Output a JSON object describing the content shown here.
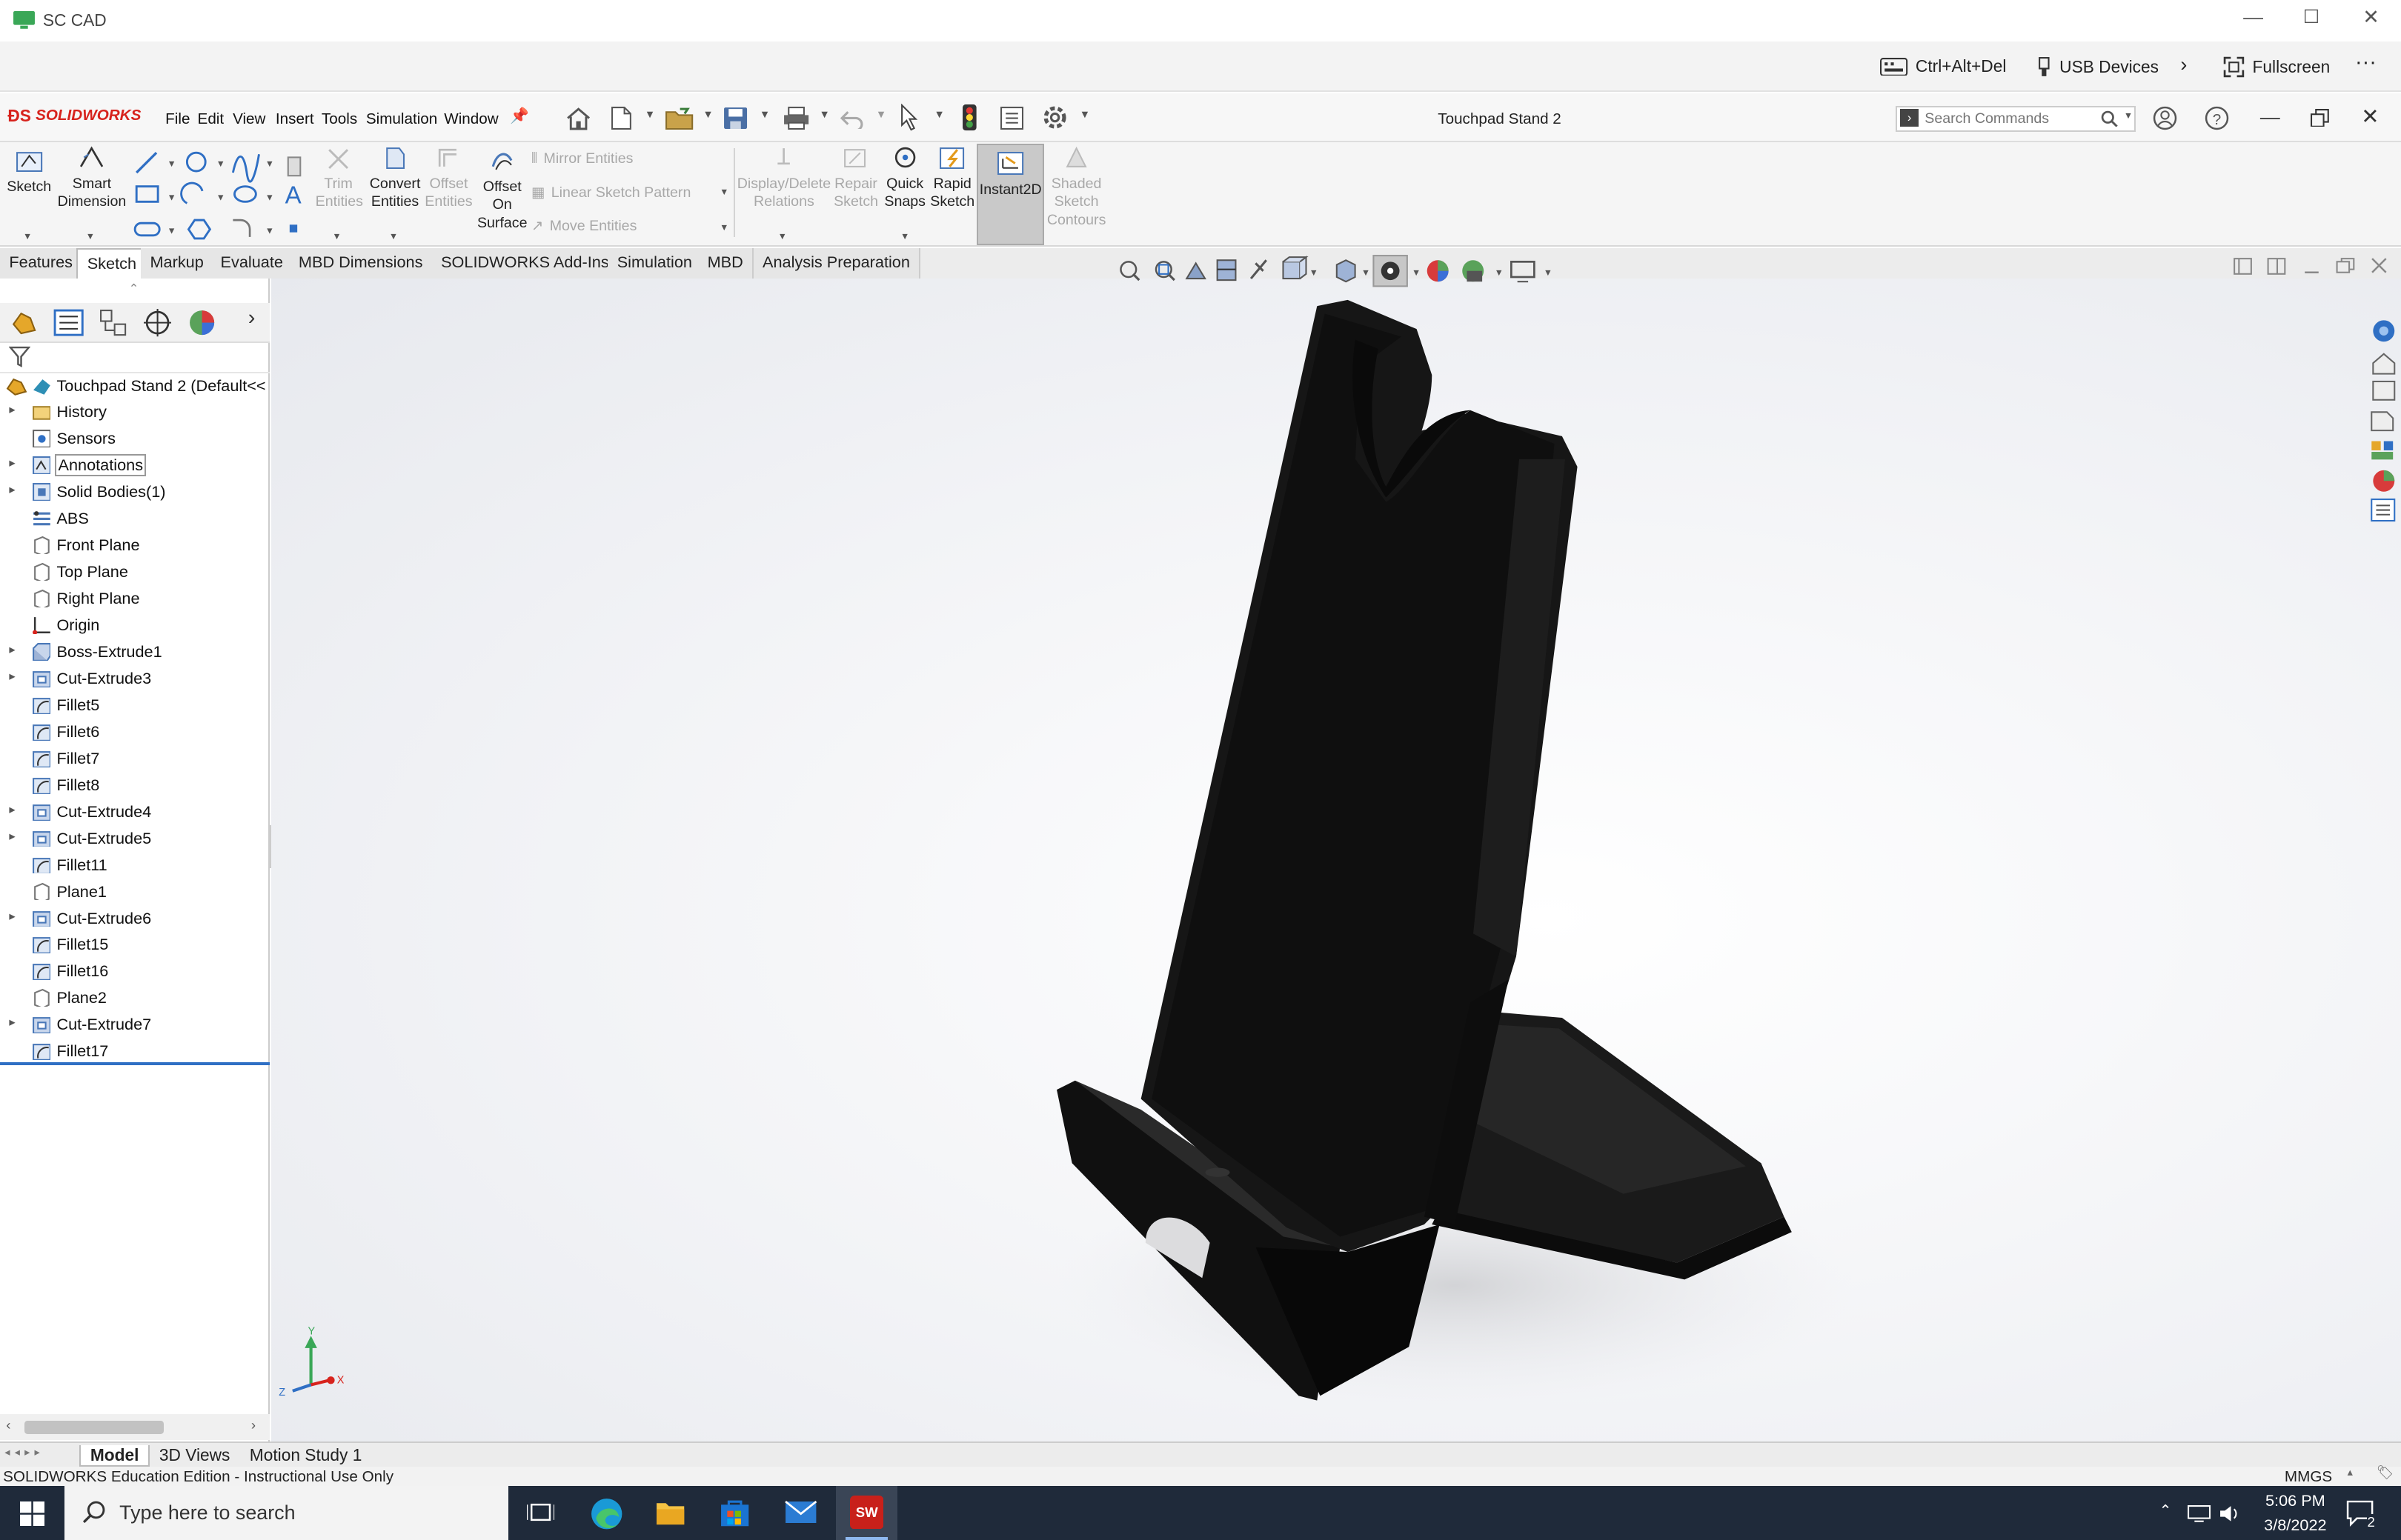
{
  "window": {
    "app_title": "SC CAD"
  },
  "remote": {
    "cad_label": "Ctrl+Alt+Del",
    "usb_label": "USB Devices",
    "fullscreen_label": "Fullscreen",
    "more": "···"
  },
  "menubar": {
    "brand": "SOLIDWORKS",
    "items": [
      "File",
      "Edit",
      "View",
      "Insert",
      "Tools",
      "Simulation",
      "Window"
    ],
    "doc_title": "Touchpad Stand 2",
    "search_placeholder": "Search Commands"
  },
  "commands": {
    "sketch": "Sketch",
    "smart_dim_1": "Smart",
    "smart_dim_2": "Dimension",
    "trim_1": "Trim",
    "trim_2": "Entities",
    "convert_1": "Convert",
    "convert_2": "Entities",
    "offset_1": "Offset",
    "offset_2": "Entities",
    "offset_surf_1": "Offset",
    "offset_surf_2": "On",
    "offset_surf_3": "Surface",
    "mirror": "Mirror Entities",
    "linear_pattern": "Linear Sketch Pattern",
    "move": "Move Entities",
    "display_1": "Display/Delete",
    "display_2": "Relations",
    "repair_1": "Repair",
    "repair_2": "Sketch",
    "quick_1": "Quick",
    "quick_2": "Snaps",
    "rapid_1": "Rapid",
    "rapid_2": "Sketch",
    "instant2d": "Instant2D",
    "shaded_1": "Shaded",
    "shaded_2": "Sketch",
    "shaded_3": "Contours"
  },
  "tabs": [
    "Features",
    "Sketch",
    "Markup",
    "Evaluate",
    "MBD Dimensions",
    "SOLIDWORKS Add-Ins",
    "Simulation",
    "MBD",
    "Analysis Preparation"
  ],
  "active_tab": "Sketch",
  "tree": {
    "root": "Touchpad Stand 2  (Default<<",
    "items": [
      {
        "label": "History",
        "icon": "history-folder-icon",
        "expandable": true
      },
      {
        "label": "Sensors",
        "icon": "sensor-icon",
        "expandable": false
      },
      {
        "label": "Annotations",
        "icon": "annotations-icon",
        "expandable": true
      },
      {
        "label": "Solid Bodies(1)",
        "icon": "solid-bodies-icon",
        "expandable": true
      },
      {
        "label": "ABS",
        "icon": "material-icon",
        "expandable": false
      },
      {
        "label": "Front Plane",
        "icon": "plane-icon",
        "expandable": false
      },
      {
        "label": "Top Plane",
        "icon": "plane-icon",
        "expandable": false
      },
      {
        "label": "Right Plane",
        "icon": "plane-icon",
        "expandable": false
      },
      {
        "label": "Origin",
        "icon": "origin-icon",
        "expandable": false
      },
      {
        "label": "Boss-Extrude1",
        "icon": "extrude-icon",
        "expandable": true
      },
      {
        "label": "Cut-Extrude3",
        "icon": "cut-extrude-icon",
        "expandable": true
      },
      {
        "label": "Fillet5",
        "icon": "fillet-icon",
        "expandable": false
      },
      {
        "label": "Fillet6",
        "icon": "fillet-icon",
        "expandable": false
      },
      {
        "label": "Fillet7",
        "icon": "fillet-icon",
        "expandable": false
      },
      {
        "label": "Fillet8",
        "icon": "fillet-icon",
        "expandable": false
      },
      {
        "label": "Cut-Extrude4",
        "icon": "cut-extrude-icon",
        "expandable": true
      },
      {
        "label": "Cut-Extrude5",
        "icon": "cut-extrude-icon",
        "expandable": true
      },
      {
        "label": "Fillet11",
        "icon": "fillet-icon",
        "expandable": false
      },
      {
        "label": "Plane1",
        "icon": "plane-icon",
        "expandable": false
      },
      {
        "label": "Cut-Extrude6",
        "icon": "cut-extrude-icon",
        "expandable": true
      },
      {
        "label": "Fillet15",
        "icon": "fillet-icon",
        "expandable": false
      },
      {
        "label": "Fillet16",
        "icon": "fillet-icon",
        "expandable": false
      },
      {
        "label": "Plane2",
        "icon": "plane-icon",
        "expandable": false
      },
      {
        "label": "Cut-Extrude7",
        "icon": "cut-extrude-icon",
        "expandable": true
      },
      {
        "label": "Fillet17",
        "icon": "fillet-icon",
        "expandable": false
      }
    ]
  },
  "triad": {
    "y": "Y",
    "x": "X",
    "z": "Z"
  },
  "bottom_tabs": [
    "Model",
    "3D Views",
    "Motion Study 1"
  ],
  "status": {
    "left": "SOLIDWORKS Education Edition - Instructional Use Only",
    "units": "MMGS"
  },
  "taskbar": {
    "search_placeholder": "Type here to search",
    "time": "5:06 PM",
    "date": "3/8/2022",
    "notifications": "2"
  },
  "colors": {
    "model": "#121212",
    "brand": "#d7231d",
    "accent_blue": "#2f6fc4",
    "taskbar": "#1f2a3a"
  }
}
